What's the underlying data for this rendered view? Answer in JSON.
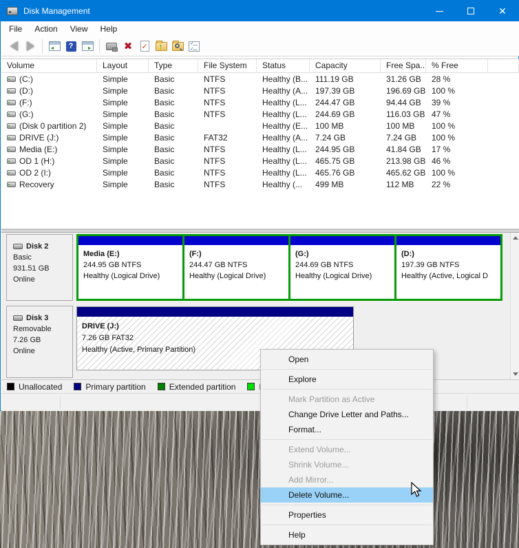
{
  "window": {
    "title": "Disk Management"
  },
  "menubar": {
    "items": [
      "File",
      "Action",
      "View",
      "Help"
    ]
  },
  "toolbar": {
    "icons": [
      "back",
      "forward",
      "show-console-tree",
      "help",
      "show-action-pane",
      "properties-tool",
      "delete",
      "validate-document",
      "open-folder-up",
      "find-folder",
      "checklist"
    ]
  },
  "volume_table": {
    "columns": [
      "Volume",
      "Layout",
      "Type",
      "File System",
      "Status",
      "Capacity",
      "Free Spa...",
      "% Free"
    ],
    "rows": [
      [
        "(C:)",
        "Simple",
        "Basic",
        "NTFS",
        "Healthy (B...",
        "111.19 GB",
        "31.26 GB",
        "28 %"
      ],
      [
        "(D:)",
        "Simple",
        "Basic",
        "NTFS",
        "Healthy (A...",
        "197.39 GB",
        "196.69 GB",
        "100 %"
      ],
      [
        "(F:)",
        "Simple",
        "Basic",
        "NTFS",
        "Healthy (L...",
        "244.47 GB",
        "94.44 GB",
        "39 %"
      ],
      [
        "(G:)",
        "Simple",
        "Basic",
        "NTFS",
        "Healthy (L...",
        "244.69 GB",
        "116.03 GB",
        "47 %"
      ],
      [
        "(Disk 0 partition 2)",
        "Simple",
        "Basic",
        "",
        "Healthy (E...",
        "100 MB",
        "100 MB",
        "100 %"
      ],
      [
        "DRIVE (J:)",
        "Simple",
        "Basic",
        "FAT32",
        "Healthy (A...",
        "7.24 GB",
        "7.24 GB",
        "100 %"
      ],
      [
        "Media (E:)",
        "Simple",
        "Basic",
        "NTFS",
        "Healthy (L...",
        "244.95 GB",
        "41.84 GB",
        "17 %"
      ],
      [
        "OD 1 (H:)",
        "Simple",
        "Basic",
        "NTFS",
        "Healthy (L...",
        "465.75 GB",
        "213.98 GB",
        "46 %"
      ],
      [
        "OD 2 (I:)",
        "Simple",
        "Basic",
        "NTFS",
        "Healthy (L...",
        "465.76 GB",
        "465.62 GB",
        "100 %"
      ],
      [
        "Recovery",
        "Simple",
        "Basic",
        "NTFS",
        "Healthy (...",
        "499 MB",
        "112 MB",
        "22 %"
      ]
    ]
  },
  "disk_view": {
    "disks": [
      {
        "name": "Disk 2",
        "type": "Basic",
        "size": "931.51 GB",
        "status": "Online",
        "partitions": [
          {
            "name": "Media  (E:)",
            "size": "244.95 GB NTFS",
            "health": "Healthy (Logical Drive)"
          },
          {
            "name": "(F:)",
            "size": "244.47 GB NTFS",
            "health": "Healthy (Logical Drive)"
          },
          {
            "name": "(G:)",
            "size": "244.69 GB NTFS",
            "health": "Healthy (Logical Drive)"
          },
          {
            "name": "(D:)",
            "size": "197.39 GB NTFS",
            "health": "Healthy (Active, Logical D"
          }
        ]
      },
      {
        "name": "Disk 3",
        "type": "Removable",
        "size": "7.26 GB",
        "status": "Online",
        "partitions": [
          {
            "name": "DRIVE  (J:)",
            "size": "7.26 GB FAT32",
            "health": "Healthy (Active, Primary Partition)"
          }
        ]
      }
    ]
  },
  "legend": {
    "items": [
      {
        "label": "Unallocated",
        "color": "#000000"
      },
      {
        "label": "Primary partition",
        "color": "#000080"
      },
      {
        "label": "Extended partition",
        "color": "#008000"
      },
      {
        "label": "Free sp",
        "color": "#00dd00"
      }
    ]
  },
  "context_menu": {
    "items": [
      {
        "label": "Open",
        "state": "enabled"
      },
      {
        "type": "separator"
      },
      {
        "label": "Explore",
        "state": "enabled",
        "group_end": true
      },
      {
        "label": "Mark Partition as Active",
        "state": "disabled"
      },
      {
        "label": "Change Drive Letter and Paths...",
        "state": "enabled"
      },
      {
        "label": "Format...",
        "state": "enabled",
        "group_end": true
      },
      {
        "label": "Extend Volume...",
        "state": "disabled"
      },
      {
        "label": "Shrink Volume...",
        "state": "disabled"
      },
      {
        "label": "Add Mirror...",
        "state": "disabled"
      },
      {
        "label": "Delete Volume...",
        "state": "highlighted",
        "group_end": true
      },
      {
        "label": "Properties",
        "state": "enabled",
        "group_end": true
      },
      {
        "label": "Help",
        "state": "enabled"
      }
    ]
  },
  "colors": {
    "titlebar": "#0078d7",
    "menu_highlight": "#99d1f7",
    "extended_border": "#089b08",
    "logical_drive_bar": "#0202cc",
    "primary_partition_bar": "#000082"
  }
}
